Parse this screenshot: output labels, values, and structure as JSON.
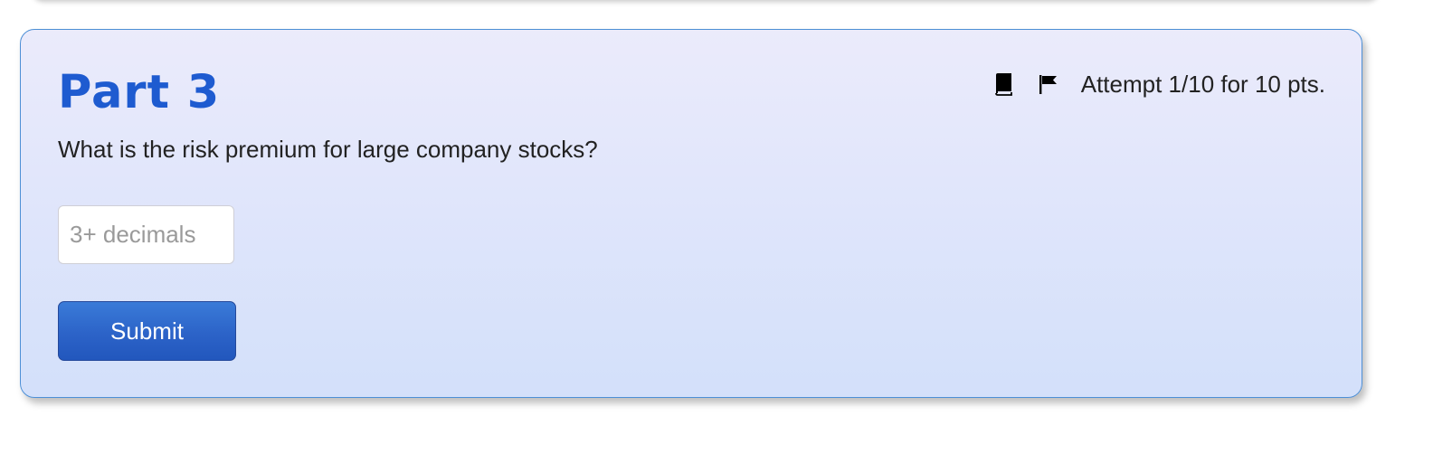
{
  "part": {
    "title": "Part 3",
    "attempt": "Attempt 1/10 for 10 pts.",
    "question": "What is the risk premium for large company stocks?",
    "answer_input": {
      "value": "",
      "placeholder": "3+ decimals"
    },
    "submit_label": "Submit",
    "icons": [
      "book-icon",
      "flag-icon"
    ]
  },
  "colors": {
    "title": "#1e5bd0",
    "card_border": "#4d8fd6",
    "submit_bg": "#2c63c8"
  }
}
